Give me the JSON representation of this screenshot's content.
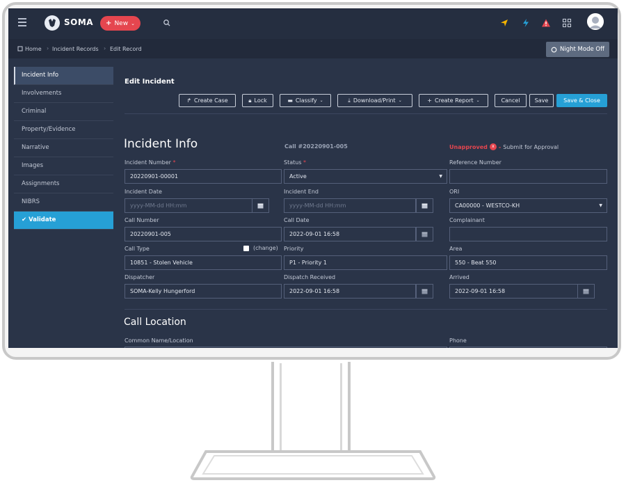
{
  "app": {
    "name": "SOMA",
    "new_label": "New"
  },
  "breadcrumb": {
    "home": "Home",
    "records": "Incident Records",
    "current": "Edit Record"
  },
  "night_mode_label": "Night Mode Off",
  "sidebar": {
    "items": [
      {
        "label": "Incident Info"
      },
      {
        "label": "Involvements"
      },
      {
        "label": "Criminal"
      },
      {
        "label": "Property/Evidence"
      },
      {
        "label": "Narrative"
      },
      {
        "label": "Images"
      },
      {
        "label": "Assignments"
      },
      {
        "label": "NIBRS"
      },
      {
        "label": "Validate"
      }
    ]
  },
  "page_title": "Edit Incident",
  "toolbar": {
    "create_case": "Create Case",
    "lock": "Lock",
    "classify": "Classify",
    "download": "Download/Print",
    "create_report": "Create Report",
    "cancel": "Cancel",
    "save": "Save",
    "save_close": "Save & Close"
  },
  "incident_info": {
    "section_title": "Incident Info",
    "call_number_header": "Call #20220901-005",
    "approval": {
      "status": "Unapproved",
      "badge": "x",
      "separator": "-",
      "action": "Submit for Approval"
    },
    "fields": {
      "incident_number": {
        "label": "Incident Number",
        "value": "20220901-00001"
      },
      "status": {
        "label": "Status",
        "value": "Active"
      },
      "reference_number": {
        "label": "Reference Number",
        "value": ""
      },
      "incident_date": {
        "label": "Incident Date",
        "placeholder": "yyyy-MM-dd HH:mm"
      },
      "incident_end": {
        "label": "Incident End",
        "placeholder": "yyyy-MM-dd HH:mm"
      },
      "ori": {
        "label": "ORI",
        "value": "CA00000 - WESTCO-KH"
      },
      "call_number": {
        "label": "Call Number",
        "value": "20220901-005"
      },
      "call_date": {
        "label": "Call Date",
        "value": "2022-09-01 16:58"
      },
      "complainant": {
        "label": "Complainant",
        "value": ""
      },
      "call_type": {
        "label": "Call Type",
        "value": "10851 - Stolen Vehicle",
        "change_label": "(change)"
      },
      "priority": {
        "label": "Priority",
        "value": "P1 - Priority 1"
      },
      "area": {
        "label": "Area",
        "value": "550 - Beat 550"
      },
      "dispatcher": {
        "label": "Dispatcher",
        "value": "SOMA-Kelly Hungerford"
      },
      "dispatch_received": {
        "label": "Dispatch Received",
        "value": "2022-09-01 16:58"
      },
      "arrived": {
        "label": "Arrived",
        "value": "2022-09-01 16:58"
      }
    }
  },
  "call_location": {
    "section_title": "Call Location",
    "common_name_label": "Common Name/Location",
    "phone_label": "Phone"
  },
  "colors": {
    "accent": "#26a0d6",
    "danger": "#e5464f",
    "background": "#2a3448",
    "topbar": "#252e40"
  }
}
